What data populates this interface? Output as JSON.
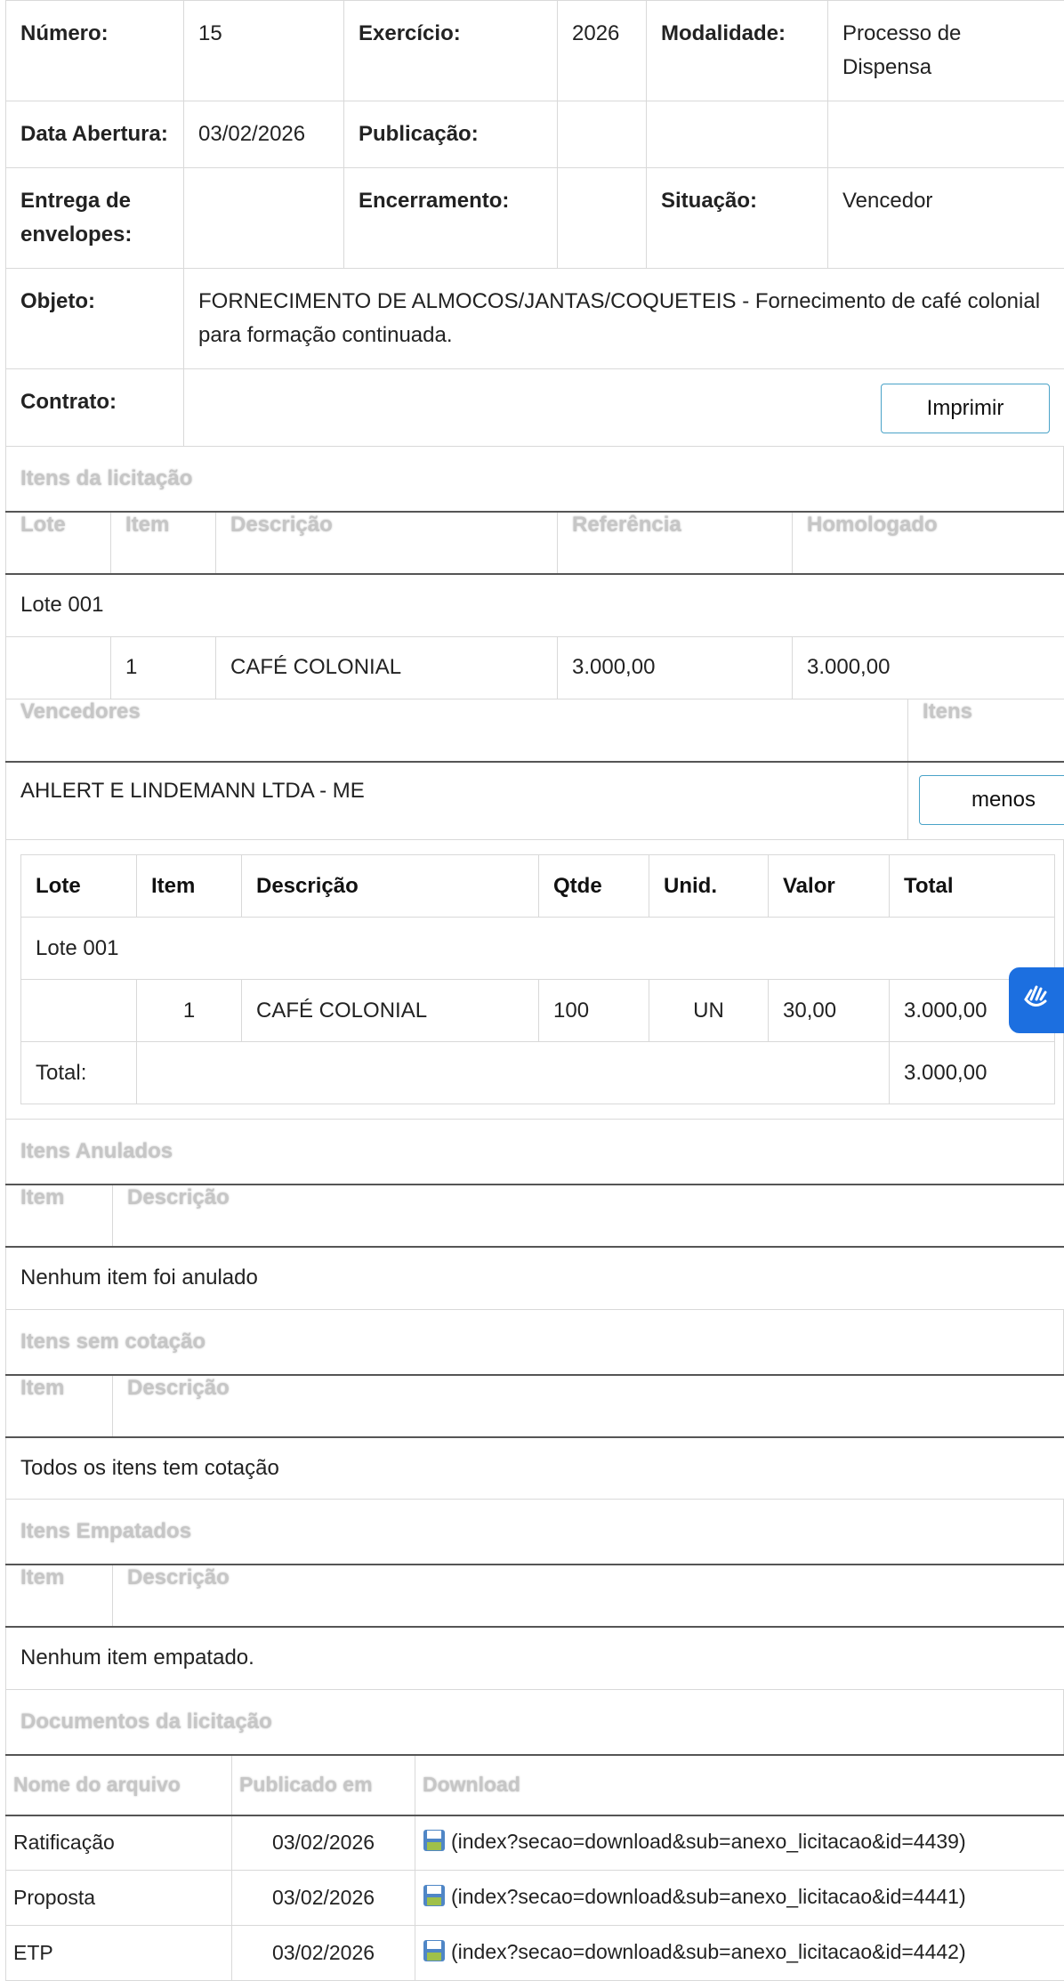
{
  "info": {
    "numero_label": "Número:",
    "numero": "15",
    "exercicio_label": "Exercício:",
    "exercicio": "2026",
    "modalidade_label": "Modalidade:",
    "modalidade": "Processo de Dispensa",
    "data_abertura_label": "Data Abertura:",
    "data_abertura": "03/02/2026",
    "publicacao_label": "Publicação:",
    "publicacao": "",
    "entrega_label": "Entrega de envelopes:",
    "entrega": "",
    "encerramento_label": "Encerramento:",
    "encerramento": "",
    "situacao_label": "Situação:",
    "situacao": "Vencedor",
    "objeto_label": "Objeto:",
    "objeto": "FORNECIMENTO DE ALMOCOS/JANTAS/COQUETEIS - Fornecimento de café colonial para formação continuada.",
    "contrato_label": "Contrato:",
    "imprimir_label": "Imprimir"
  },
  "itens_licitacao": {
    "title": "Itens da licitação",
    "headers": [
      "Lote",
      "Item",
      "Descrição",
      "Referência",
      "Homologado"
    ],
    "lote_label": "Lote 001",
    "row": {
      "lote": "",
      "item": "1",
      "descricao": "CAFÉ COLONIAL",
      "referencia": "3.000,00",
      "homologado": "3.000,00"
    }
  },
  "vencedores": {
    "title": "Vencedores",
    "itens_title": "Itens",
    "name": "AHLERT E LINDEMANN LTDA - ME",
    "menos_label": "menos",
    "headers": [
      "Lote",
      "Item",
      "Descrição",
      "Qtde",
      "Unid.",
      "Valor",
      "Total"
    ],
    "lote_label": "Lote 001",
    "row": {
      "lote": "",
      "item": "1",
      "descricao": "CAFÉ COLONIAL",
      "qtde": "100",
      "unid": "UN",
      "valor": "30,00",
      "total": "3.000,00"
    },
    "total_label": "Total:",
    "total_value": "3.000,00"
  },
  "anulados": {
    "title": "Itens Anulados",
    "headers": [
      "Item",
      "Descrição"
    ],
    "message": "Nenhum item foi anulado"
  },
  "sem_cotacao": {
    "title": "Itens sem cotação",
    "headers": [
      "Item",
      "Descrição"
    ],
    "message": "Todos os itens tem cotação"
  },
  "empatados": {
    "title": "Itens Empatados",
    "headers": [
      "Item",
      "Descrição"
    ],
    "message": "Nenhum item empatado."
  },
  "documentos": {
    "title": "Documentos da licitação",
    "headers": [
      "Nome do arquivo",
      "Publicado em",
      "Download"
    ],
    "rows": [
      {
        "nome": "Ratificação",
        "data": "03/02/2026",
        "link": "(index?secao=download&sub=anexo_licitacao&id=4439)"
      },
      {
        "nome": "Proposta",
        "data": "03/02/2026",
        "link": "(index?secao=download&sub=anexo_licitacao&id=4441)"
      },
      {
        "nome": "ETP",
        "data": "03/02/2026",
        "link": "(index?secao=download&sub=anexo_licitacao&id=4442)"
      }
    ]
  },
  "colors": {
    "accent": "#1c6fe0",
    "button_border": "#4aa3c8",
    "header_text": "#c6c6c6"
  },
  "icons": {
    "floppy": "floppy-disk-icon",
    "accessibility": "sign-language-icon"
  }
}
